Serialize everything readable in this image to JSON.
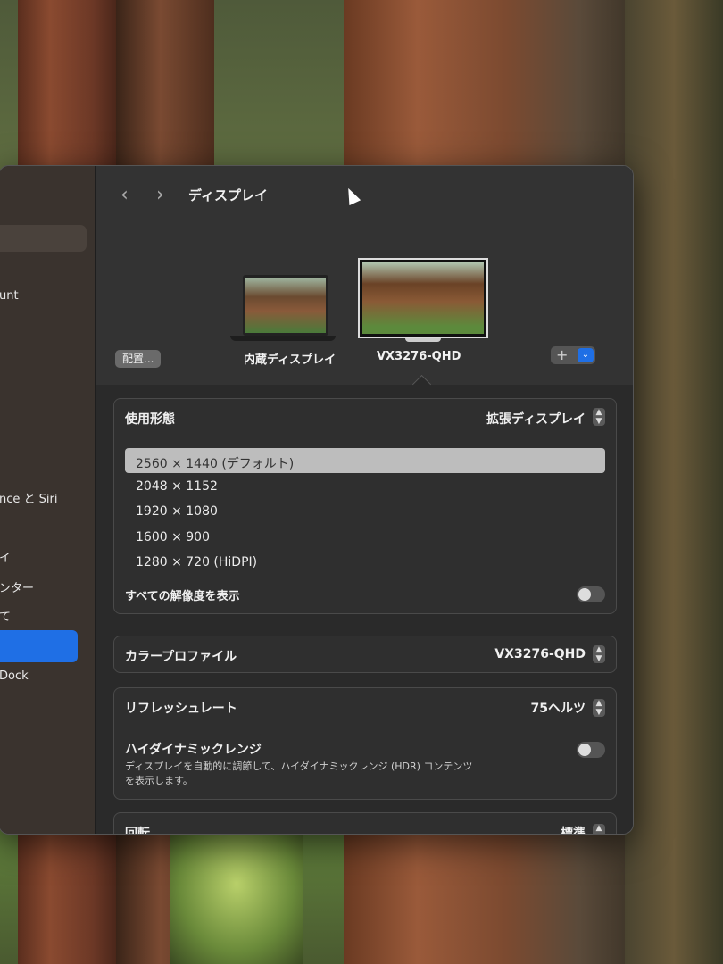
{
  "sidebar": {
    "items": [
      "unt",
      "nce と Siri",
      "イ",
      "ンター",
      "て",
      "Dock"
    ]
  },
  "header": {
    "back_icon": "‹",
    "forward_icon": "›",
    "title": "ディスプレイ"
  },
  "displays": {
    "arrange_label": "配置...",
    "builtin_label": "内蔵ディスプレイ",
    "external_label": "VX3276-QHD",
    "add_label": "+",
    "add_menu_icon": "⌄"
  },
  "usage": {
    "label": "使用形態",
    "value": "拡張ディスプレイ",
    "resolutions": [
      "2560 × 1440 (デフォルト)",
      "2048 × 1152",
      "1920 × 1080",
      "1600 × 900",
      "1280 × 720 (HiDPI)"
    ],
    "show_all_label": "すべての解像度を表示",
    "show_all_on": false
  },
  "color_profile": {
    "label": "カラープロファイル",
    "value": "VX3276-QHD"
  },
  "refresh": {
    "label": "リフレッシュレート",
    "value": "75ヘルツ"
  },
  "hdr": {
    "label": "ハイダイナミックレンジ",
    "desc_line1": "ディスプレイを自動的に調節して、ハイダイナミックレンジ (HDR) コンテンツ",
    "desc_line2": "を表示します。",
    "on": false
  },
  "rotation": {
    "label": "回転",
    "value": "標準"
  },
  "colors": {
    "accent": "#1f6fe5"
  }
}
